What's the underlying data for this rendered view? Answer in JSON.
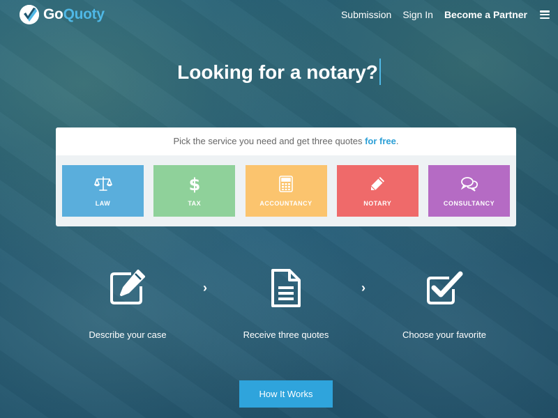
{
  "brand": {
    "go": "Go",
    "quoty": "Quoty"
  },
  "nav": {
    "submission": "Submission",
    "sign_in": "Sign In",
    "become_partner": "Become a Partner",
    "menu_icon": "hamburger-icon"
  },
  "hero": {
    "headline": "Looking for a notary?"
  },
  "services": {
    "prompt_prefix": "Pick the service you need and get three quotes ",
    "prompt_highlight": "for free",
    "prompt_suffix": ".",
    "tiles": [
      {
        "label": "LAW",
        "icon": "scales-icon",
        "color": "#5aaedc"
      },
      {
        "label": "TAX",
        "icon": "dollar-icon",
        "color": "#8fd19a"
      },
      {
        "label": "ACCOUNTANCY",
        "icon": "calculator-icon",
        "color": "#fbc46e"
      },
      {
        "label": "NOTARY",
        "icon": "pencil-icon",
        "color": "#ef6a6a"
      },
      {
        "label": "CONSULTANCY",
        "icon": "chat-bubbles-icon",
        "color": "#b56bc4"
      }
    ]
  },
  "steps": [
    {
      "label": "Describe your case",
      "icon": "edit-icon"
    },
    {
      "label": "Receive three quotes",
      "icon": "document-icon"
    },
    {
      "label": "Choose your favorite",
      "icon": "checkbox-icon"
    }
  ],
  "step_arrow": "›",
  "cta": {
    "label": "How It Works"
  }
}
